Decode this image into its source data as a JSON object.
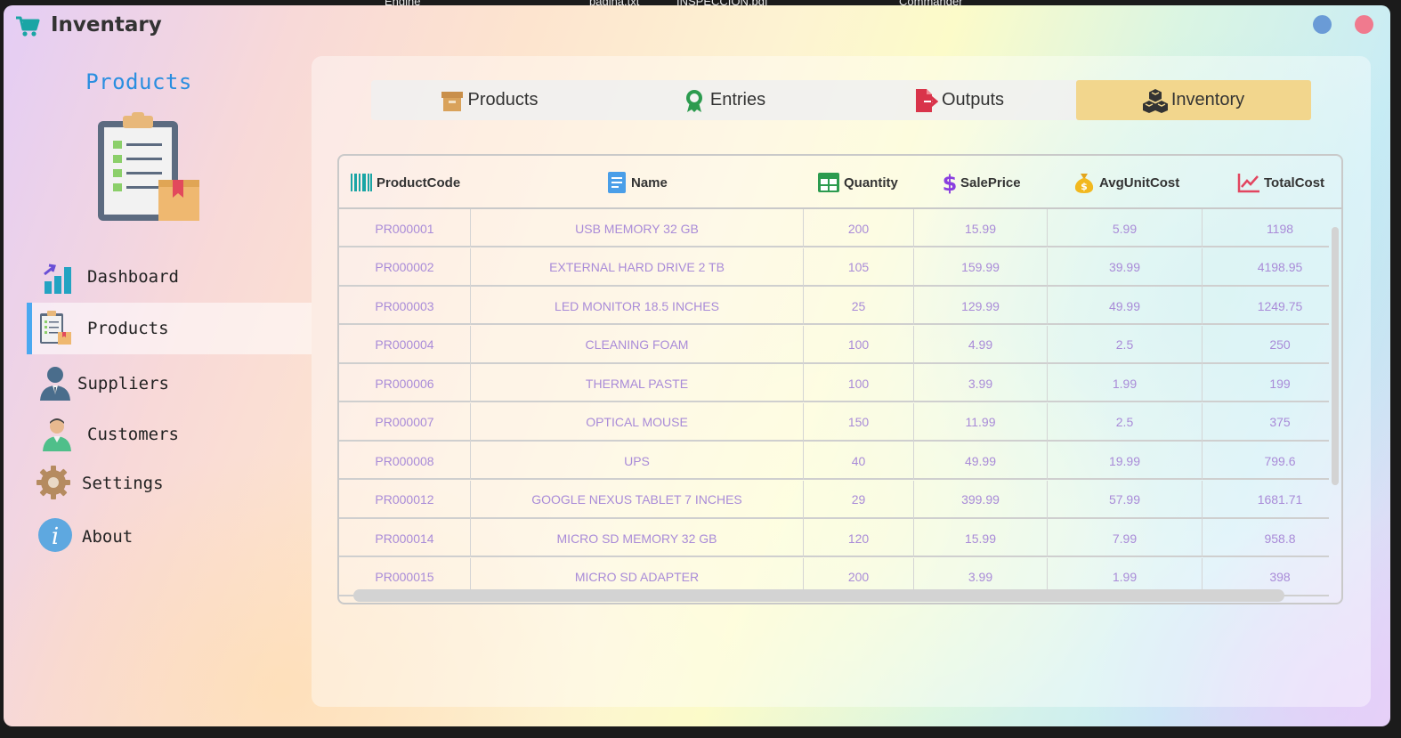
{
  "app": {
    "title": "Inventary"
  },
  "desktop": [
    "Engine",
    "pagina.txt",
    "INSPECCION.pdf",
    "Commander"
  ],
  "sidebar": {
    "heading": "Products",
    "items": [
      {
        "label": "Dashboard",
        "icon": "bar-chart-icon"
      },
      {
        "label": "Products",
        "icon": "clipboard-icon",
        "active": true
      },
      {
        "label": "Suppliers",
        "icon": "person-suit-icon"
      },
      {
        "label": "Customers",
        "icon": "customer-icon"
      },
      {
        "label": "Settings",
        "icon": "gear-icon"
      },
      {
        "label": "About",
        "icon": "info-icon"
      }
    ]
  },
  "tabs": [
    {
      "label": "Products",
      "icon": "box-icon"
    },
    {
      "label": "Entries",
      "icon": "award-icon"
    },
    {
      "label": "Outputs",
      "icon": "exit-file-icon"
    },
    {
      "label": "Inventory",
      "icon": "boxes-icon",
      "active": true
    }
  ],
  "table": {
    "columns": [
      "ProductCode",
      "Name",
      "Quantity",
      "SalePrice",
      "AvgUnitCost",
      "TotalCost"
    ],
    "rows": [
      [
        "PR000001",
        "USB MEMORY 32 GB",
        "200",
        "15.99",
        "5.99",
        "1198"
      ],
      [
        "PR000002",
        "EXTERNAL HARD DRIVE 2 TB",
        "105",
        "159.99",
        "39.99",
        "4198.95"
      ],
      [
        "PR000003",
        "LED MONITOR 18.5 INCHES",
        "25",
        "129.99",
        "49.99",
        "1249.75"
      ],
      [
        "PR000004",
        "CLEANING FOAM",
        "100",
        "4.99",
        "2.5",
        "250"
      ],
      [
        "PR000006",
        "THERMAL PASTE",
        "100",
        "3.99",
        "1.99",
        "199"
      ],
      [
        "PR000007",
        "OPTICAL MOUSE",
        "150",
        "11.99",
        "2.5",
        "375"
      ],
      [
        "PR000008",
        "UPS",
        "40",
        "49.99",
        "19.99",
        "799.6"
      ],
      [
        "PR000012",
        "GOOGLE NEXUS TABLET 7 INCHES",
        "29",
        "399.99",
        "57.99",
        "1681.71"
      ],
      [
        "PR000014",
        "MICRO SD MEMORY 32 GB",
        "120",
        "15.99",
        "7.99",
        "958.8"
      ],
      [
        "PR000015",
        "MICRO SD ADAPTER",
        "200",
        "3.99",
        "1.99",
        "398"
      ]
    ]
  },
  "colors": {
    "accent_blue": "#2a8ee0",
    "active_tab": "#f2d68d",
    "cell_text": "#a98bd8",
    "close_button": "#f07a8e",
    "minimize_button": "#6a9bd6"
  }
}
